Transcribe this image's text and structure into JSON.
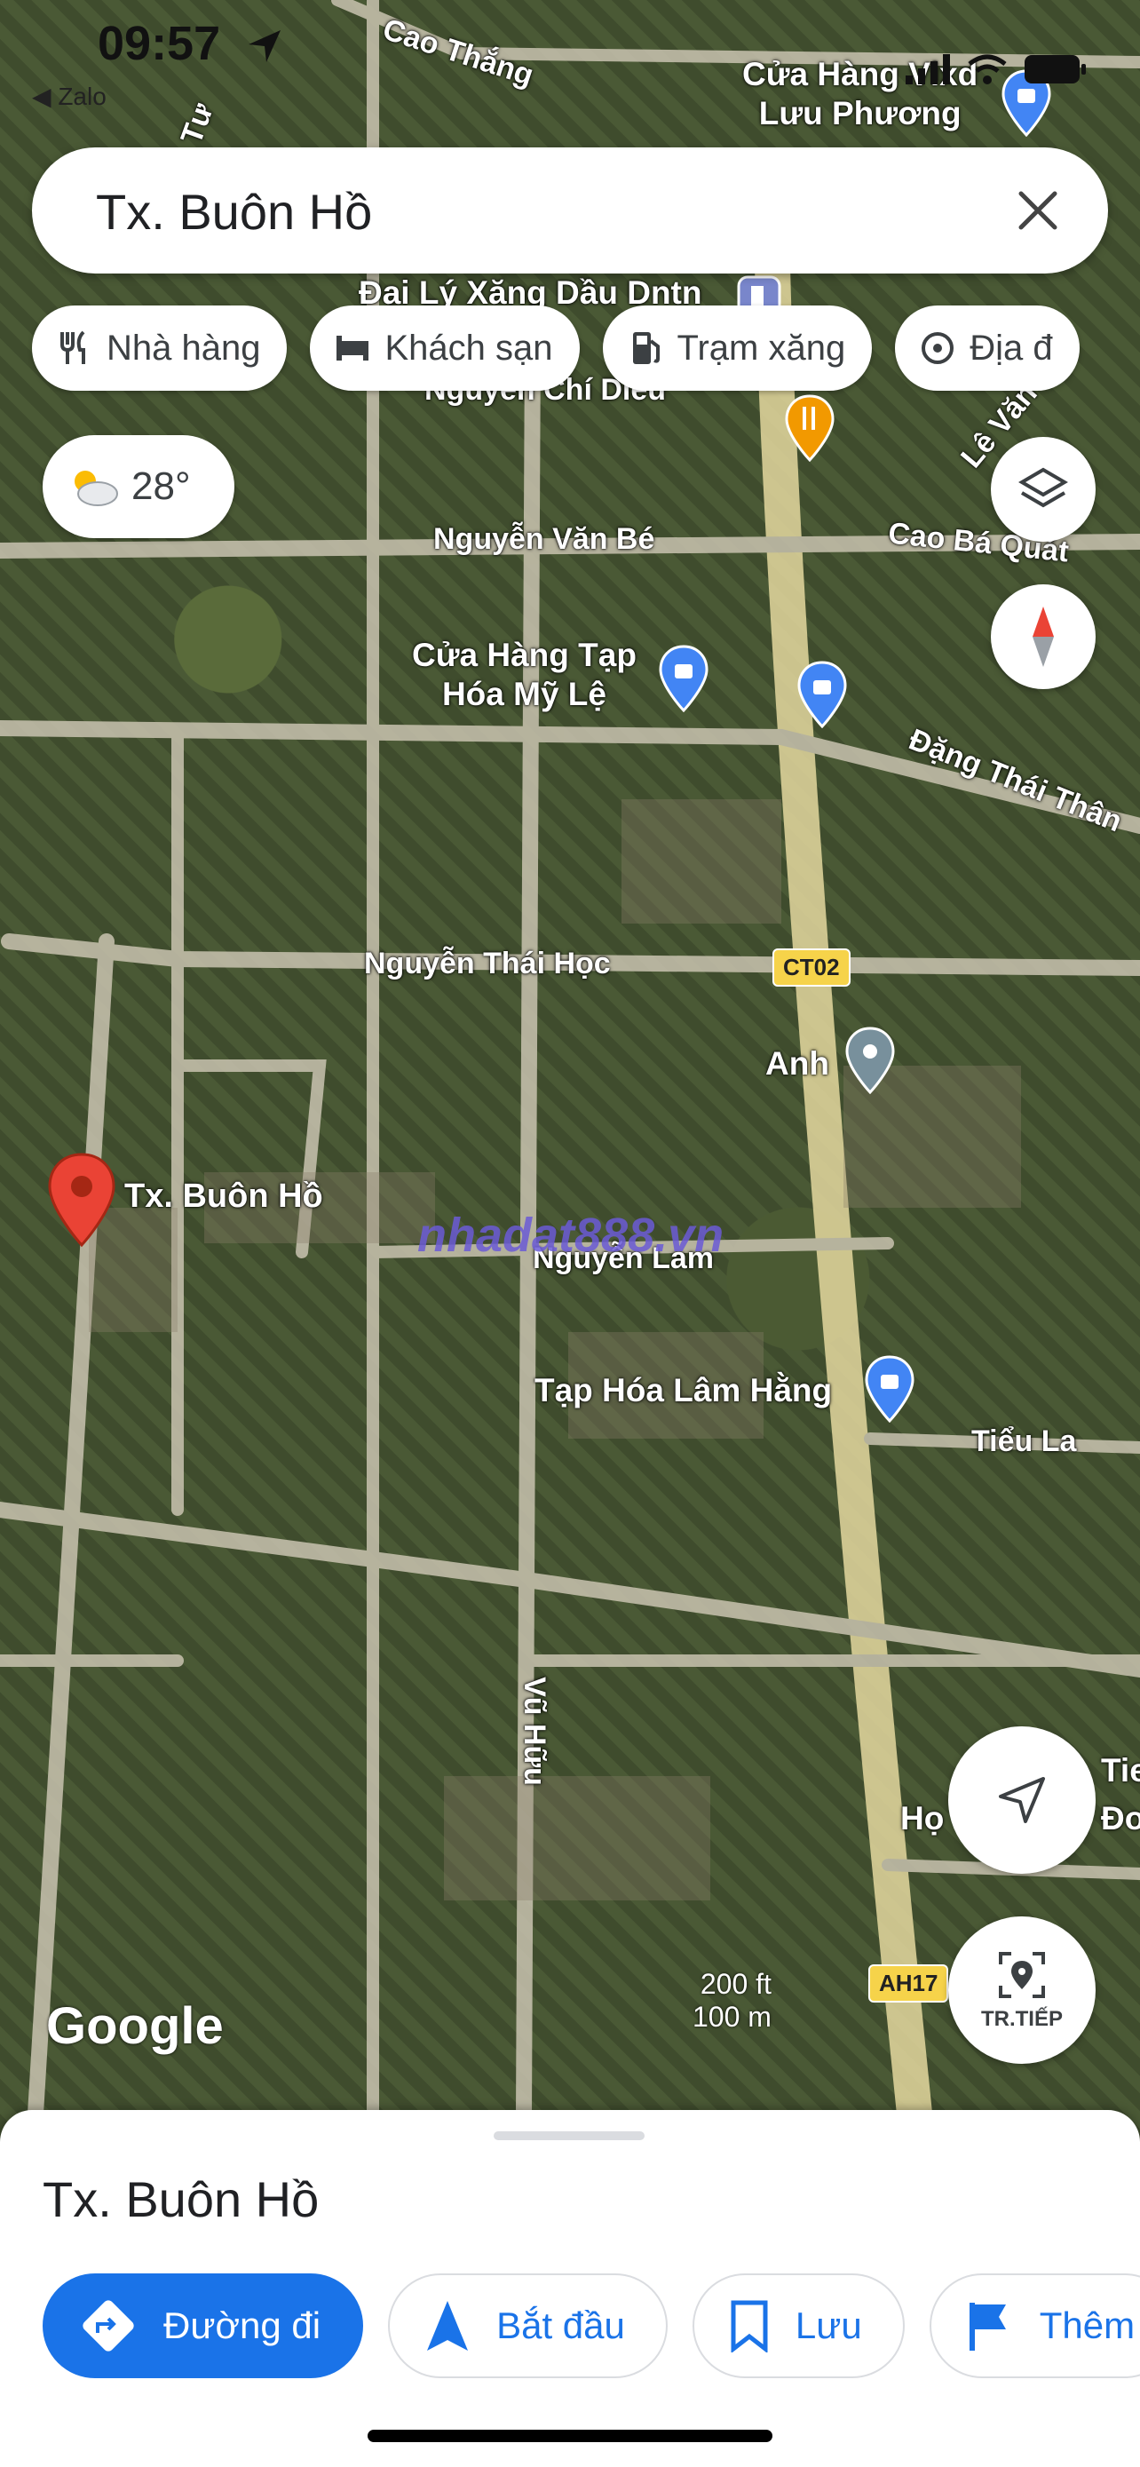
{
  "status_bar": {
    "time": "09:57",
    "back_app": "◀ Zalo"
  },
  "search": {
    "query": "Tx. Buôn Hồ"
  },
  "chips": [
    {
      "label": "Nhà hàng",
      "icon": "restaurant-icon"
    },
    {
      "label": "Khách sạn",
      "icon": "hotel-icon"
    },
    {
      "label": "Trạm xăng",
      "icon": "gas-station-icon"
    },
    {
      "label": "Địa đ",
      "icon": "attraction-icon"
    }
  ],
  "weather": {
    "temp": "28°",
    "icon": "partly-cloudy-icon"
  },
  "map": {
    "streets": {
      "cao_thang": "Cao Thắng",
      "nguyen_chi_dieu": "Nguyễn Chí Diểu",
      "nguyen_van_be": "Nguyễn Văn Bé",
      "cao_ba_quat": "Cao Bá Quát",
      "le_van": "Lê Văn",
      "dang_thai_than": "Đặng Thái Thân",
      "nguyen_thai_hoc": "Nguyễn Thái Học",
      "nguyen_lam": "Nguyễn Lam",
      "tieu_la": "Tiểu La",
      "vu_huu": "Vũ Hữu",
      "tu": "Tư"
    },
    "pois": {
      "cua_hang_top": "Cửa Hàng Vlxd",
      "cua_hang_top_2": "Lưu Phương",
      "dai_ly": "Đại Lý Xăng Dầu Dntn",
      "tap_hoa_my_le_1": "Cửa Hàng Tạp",
      "tap_hoa_my_le_2": "Hóa Mỹ Lệ",
      "anh": "Anh",
      "tap_hoa_lam_hang": "Tạp Hóa Lâm Hằng",
      "ho": "Họ",
      "tie": "Tie",
      "do": "Đơ"
    },
    "shield_ct02": "CT02",
    "shield_ah17": "AH17",
    "selected_pin": "Tx. Buôn Hồ",
    "watermark": "nhadat888.vn",
    "google": "Google",
    "scale_ft": "200 ft",
    "scale_m": "100 m",
    "directions_next": "TR.TIẾP"
  },
  "sheet": {
    "title": "Tx. Buôn Hồ",
    "actions": [
      {
        "label": "Đường đi"
      },
      {
        "label": "Bắt đầu"
      },
      {
        "label": "Lưu"
      },
      {
        "label": "Thêm"
      }
    ]
  }
}
